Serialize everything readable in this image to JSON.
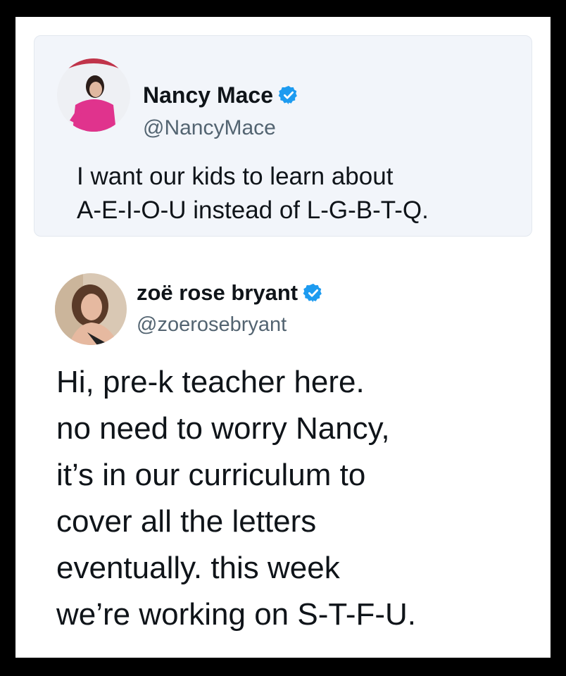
{
  "quoted_tweet": {
    "author_name": "Nancy Mace",
    "handle": "@NancyMace",
    "verified": true,
    "text": "I want our kids to learn about\nA-E-I-O-U instead of L-G-B-T-Q.",
    "avatar_icon": "profile-photo"
  },
  "reply_tweet": {
    "author_name": "zoë rose bryant",
    "handle": "@zoerosebryant",
    "verified": true,
    "text": "Hi, pre-k teacher here.\nno need to worry Nancy,\nit’s in our curriculum to\ncover all the letters\neventually. this week\nwe’re working on S-T-F-U.",
    "avatar_icon": "profile-photo"
  },
  "colors": {
    "frame_border": "#000000",
    "background": "#ffffff",
    "quoted_bg": "#f2f5fa",
    "text": "#0f1419",
    "handle": "#536471",
    "verified_badge": "#1d9bf0"
  }
}
